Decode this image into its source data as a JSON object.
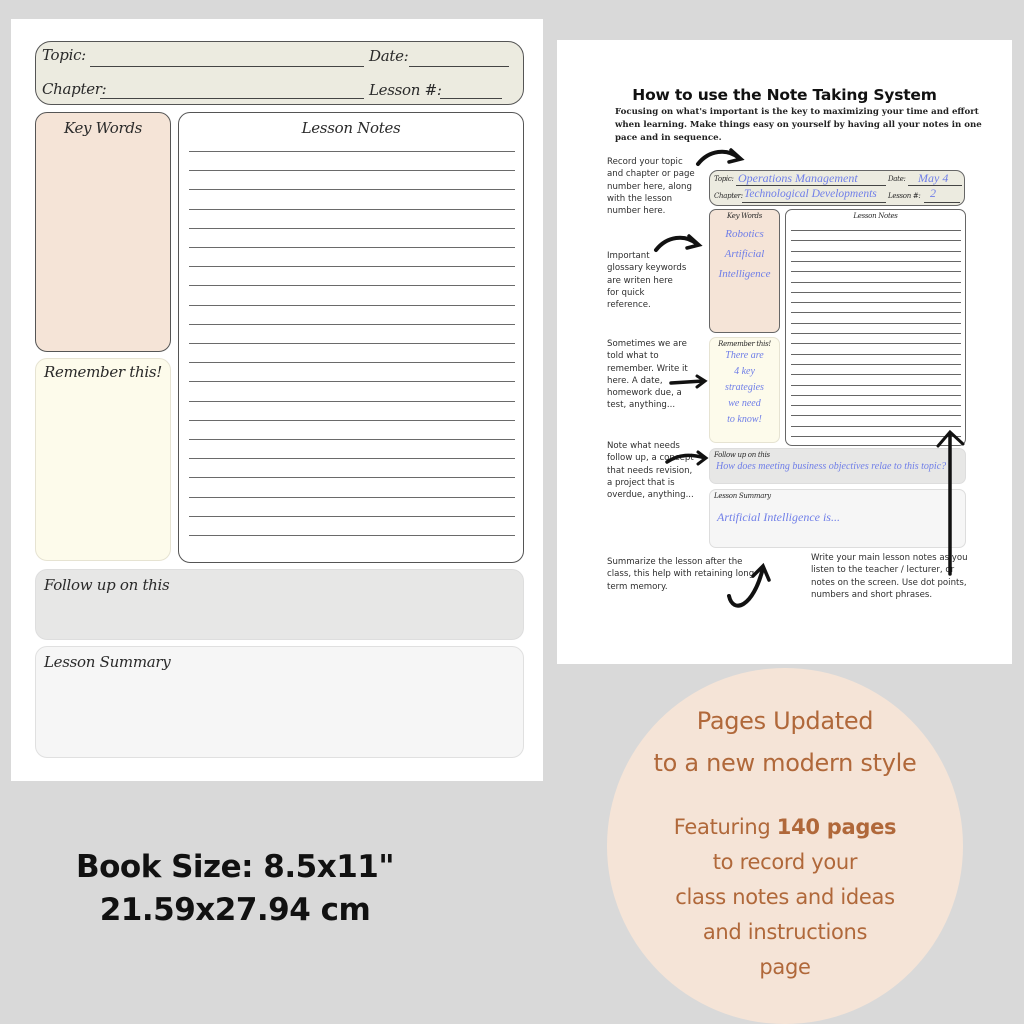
{
  "template_page": {
    "header": {
      "topic_label": "Topic:",
      "date_label": "Date:",
      "chapter_label": "Chapter:",
      "lesson_label": "Lesson #:"
    },
    "key_words_title": "Key Words",
    "remember_title": "Remember this!",
    "lesson_notes_title": "Lesson Notes",
    "lesson_notes_line_count": 21,
    "follow_up_title": "Follow up on this",
    "summary_title": "Lesson Summary"
  },
  "instructions_page": {
    "title": "How to use the Note Taking System",
    "intro": "Focusing on what's important is the key to maximizing your time and effort when learning. Make things easy on yourself by having all your notes in one pace and in sequence.",
    "notes": {
      "header": "Record your topic and chapter or page number here, along with the lesson number here.",
      "keywords": "Important glossary keywords are writen here for quick reference.",
      "remember": "Sometimes we are told what to remember. Write it here. A date, homework due, a test, anything...",
      "follow_up": "Note what needs follow up, a concept that needs revision, a project that is overdue, anything...",
      "summary": "Summarize the lesson after the class, this help with retaining long term memory.",
      "lesson_notes": "Write your main lesson notes as you listen to the teacher / lecturer, or notes on the screen. Use dot points, numbers  and short phrases."
    },
    "example": {
      "topic_label": "Topic:",
      "topic_value": "Operations Management",
      "date_label": "Date:",
      "date_value": "May 4",
      "chapter_label": "Chapter:",
      "chapter_value": "Technological Developments",
      "lesson_label": "Lesson #:",
      "lesson_value": "2",
      "key_words_title": "Key Words",
      "key_words": [
        "Robotics",
        "Artificial",
        "Intelligence"
      ],
      "remember_title": "Remember this!",
      "remember_lines": [
        "There are",
        "4 key",
        "strategies",
        "we need",
        "to know!"
      ],
      "lesson_notes_title": "Lesson Notes",
      "lesson_notes_line_count": 21,
      "follow_up_title": "Follow up on this",
      "follow_up_value": "How does meeting business objectives relae to this topic?",
      "summary_title": "Lesson Summary",
      "summary_value": "Artificial Intelligence is..."
    }
  },
  "book_size": {
    "line1": "Book Size: 8.5x11\"",
    "line2": "21.59x27.94 cm"
  },
  "promo": {
    "line1": "Pages Updated",
    "line2": "to a new modern style",
    "featuring_prefix": "Featuring ",
    "featuring_bold": "140 pages",
    "line4": "to record your",
    "line5": "class notes and ideas",
    "line6": "and instructions",
    "line7": "page"
  },
  "colors": {
    "background": "#d9d9d9",
    "header_fill": "#ecebe0",
    "key_words_fill": "#f5e4d7",
    "remember_fill": "#fdfbeb",
    "follow_up_fill": "#e7e7e6",
    "summary_fill": "#f6f6f6",
    "handwriting_blue": "#6f7ee8",
    "promo_circle": "#f5e4d7",
    "promo_text": "#b0683a"
  }
}
